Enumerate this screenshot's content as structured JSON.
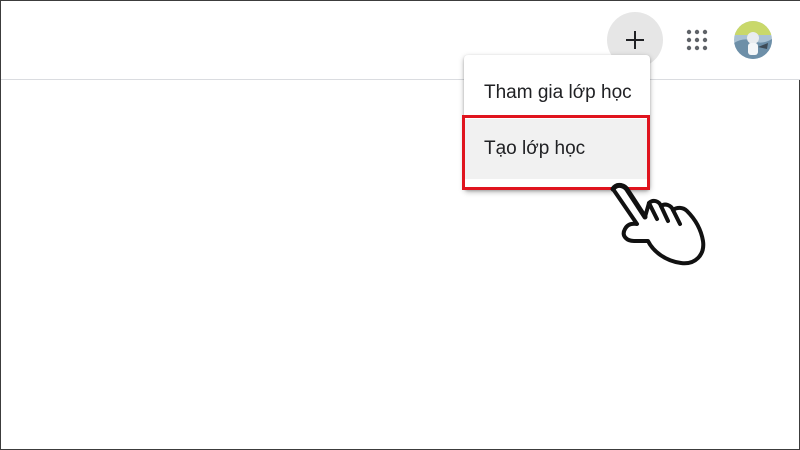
{
  "header": {
    "add_icon": "plus-icon",
    "apps_icon": "grid-icon",
    "avatar_icon": "user-avatar"
  },
  "menu": {
    "items": [
      {
        "label": "Tham gia lớp học"
      },
      {
        "label": "Tạo lớp học"
      }
    ]
  },
  "annotation": {
    "highlight_color": "#e0141e",
    "pointer_icon": "pointing-hand-icon"
  }
}
